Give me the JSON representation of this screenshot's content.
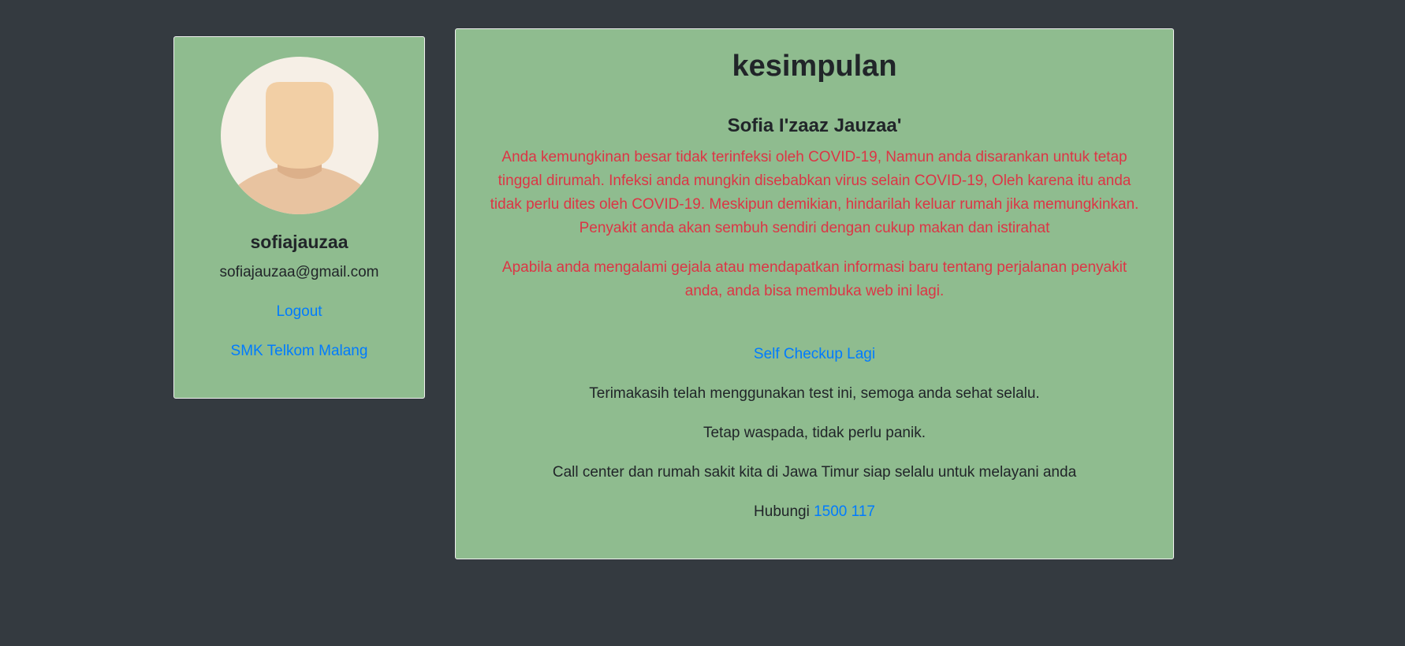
{
  "profile": {
    "username": "sofiajauzaa",
    "email": "sofiajauzaa@gmail.com",
    "logout_label": "Logout",
    "school_label": "SMK Telkom Malang",
    "avatar_icon": "person-placeholder-icon"
  },
  "main": {
    "title": "kesimpulan",
    "patient_name": "Sofia I'zaaz Jauzaa'",
    "result_paragraph_1": "Anda kemungkinan besar tidak terinfeksi oleh COVID-19, Namun anda disarankan untuk tetap tinggal dirumah. Infeksi anda mungkin disebabkan virus selain COVID-19, Oleh karena itu anda tidak perlu dites oleh COVID-19. Meskipun demikian, hindarilah keluar rumah jika memungkinkan. Penyakit anda akan sembuh sendiri dengan cukup makan dan istirahat",
    "result_paragraph_2": "Apabila anda mengalami gejala atau mendapatkan informasi baru tentang perjalanan penyakit anda, anda bisa membuka web ini lagi.",
    "recheck_label": "Self Checkup Lagi",
    "thanks_text": "Terimakasih telah menggunakan test ini, semoga anda sehat selalu.",
    "alert_text": "Tetap waspada, tidak perlu panik.",
    "callcenter_text": "Call center dan rumah sakit kita di Jawa Timur siap selalu untuk melayani anda",
    "contact_prefix": "Hubungi",
    "contact_number": "1500 117"
  },
  "colors": {
    "background": "#343a40",
    "card": "#8fbc8f",
    "link": "#007bff",
    "danger": "#dc3545"
  }
}
